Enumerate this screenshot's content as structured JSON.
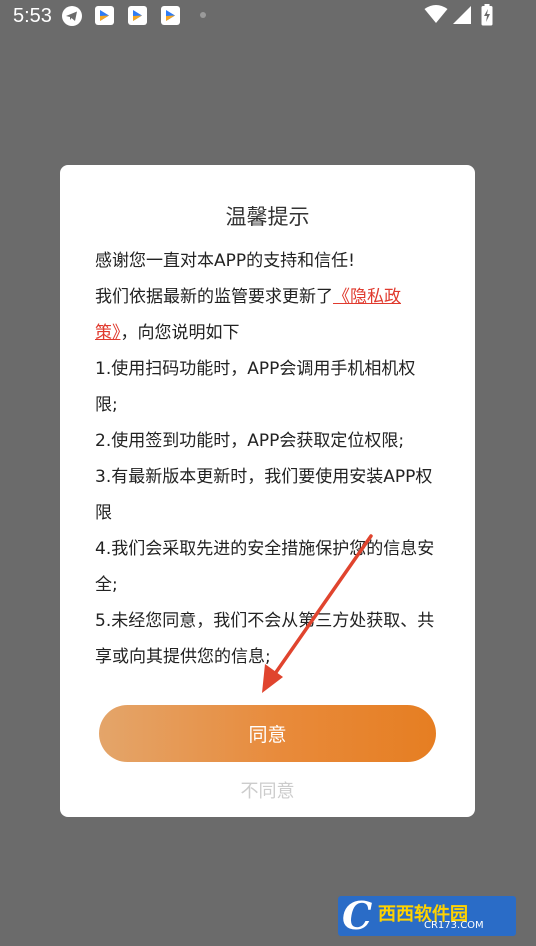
{
  "status_bar": {
    "time": "5:53"
  },
  "dialog": {
    "title": "温馨提示",
    "line1": "感谢您一直对本APP的支持和信任!",
    "line2_prefix": "我们依据最新的监管要求更新了",
    "policy_link": "《隐私政策》",
    "line2_suffix": "，向您说明如下",
    "item1": "1.使用扫码功能时，APP会调用手机相机权限;",
    "item2": "2.使用签到功能时，APP会获取定位权限;",
    "item3": "3.有最新版本更新时，我们要使用安装APP权限",
    "item4": "4.我们会采取先进的安全措施保护您的信息安全;",
    "item5": "5.未经您同意，我们不会从第三方处获取、共享或向其提供您的信息;",
    "agree_label": "同意",
    "disagree_label": "不同意"
  },
  "watermark": {
    "logo_letter": "C",
    "name": "西西软件园",
    "domain": "CR173.COM"
  },
  "colors": {
    "link": "#e03a2e",
    "button_start": "#e4a56a",
    "button_end": "#e67e22",
    "arrow": "#e0442e",
    "overlay": "#6b6b6b"
  }
}
